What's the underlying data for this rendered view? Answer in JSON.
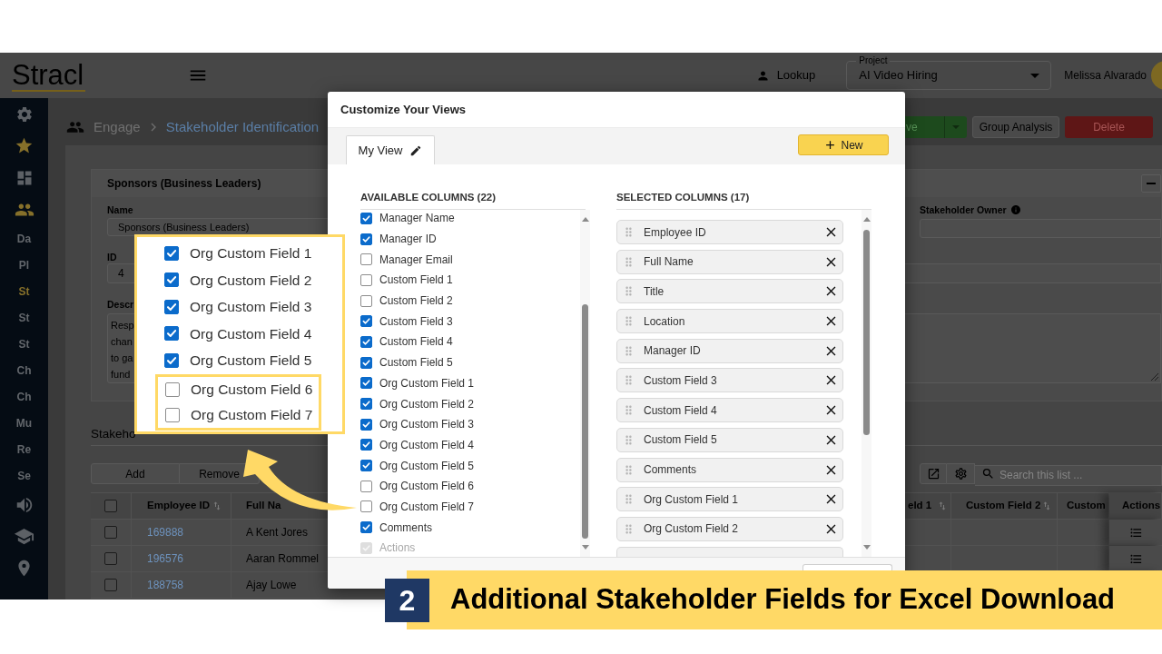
{
  "header": {
    "logo": "Stracl",
    "lookup": "Lookup",
    "project": {
      "label": "Project",
      "value": "AI Video Hiring"
    },
    "user": "Melissa Alvarado"
  },
  "sidebar": {
    "items": [
      {
        "kind": "icon",
        "highlighted": false
      },
      {
        "kind": "icon",
        "highlighted": true
      },
      {
        "kind": "icon",
        "highlighted": false
      },
      {
        "kind": "icon",
        "highlighted": true
      },
      {
        "kind": "text",
        "label": "Da",
        "highlighted": false
      },
      {
        "kind": "text",
        "label": "Pl",
        "highlighted": false
      },
      {
        "kind": "text",
        "label": "St",
        "highlighted": true
      },
      {
        "kind": "text",
        "label": "St",
        "highlighted": false
      },
      {
        "kind": "text",
        "label": "St",
        "highlighted": false
      },
      {
        "kind": "text",
        "label": "Ch",
        "highlighted": false
      },
      {
        "kind": "text",
        "label": "Ch",
        "highlighted": false
      },
      {
        "kind": "text",
        "label": "Mu",
        "highlighted": false
      },
      {
        "kind": "text",
        "label": "Re",
        "highlighted": false
      },
      {
        "kind": "text",
        "label": "Se",
        "highlighted": false
      },
      {
        "kind": "icon",
        "highlighted": false
      },
      {
        "kind": "icon",
        "highlighted": false
      },
      {
        "kind": "icon",
        "highlighted": false
      }
    ]
  },
  "breadcrumb": [
    "Engage",
    "Stakeholder Identification"
  ],
  "actions": [
    {
      "kind": "split",
      "label": "ve"
    },
    {
      "kind": "plain",
      "label": "Group Analysis"
    },
    {
      "kind": "danger",
      "label": "Delete"
    }
  ],
  "card": {
    "title": "Sponsors (Business Leaders)",
    "name": {
      "label": "Name",
      "value": "Sponsors (Business Leaders)"
    },
    "owner": {
      "label": "Stakeholder Owner"
    },
    "id": {
      "label": "ID",
      "value": "4"
    },
    "description": {
      "label": "Descr",
      "lines": [
        "Resp",
        "chan",
        "to ga",
        "fund"
      ]
    }
  },
  "stakeholders": {
    "title": "Stakeho",
    "buttons": [
      "Add",
      "Remove"
    ],
    "search": {
      "placeholder": "Search this list ..."
    }
  },
  "table": {
    "all_checked": false,
    "columns": [
      {
        "label": "Employee ID",
        "sortable": true
      },
      {
        "label": "Full Na",
        "sortable": false
      },
      {
        "label": "eld 1",
        "sortable": true
      },
      {
        "label": "Custom Field 2",
        "sortable": true
      },
      {
        "label": "Custom",
        "sortable": false
      },
      {
        "label": "Actions",
        "sortable": false
      }
    ],
    "rows": [
      {
        "checked": false,
        "cells": [
          "169888",
          "A Kent Jores"
        ],
        "menu": true
      },
      {
        "checked": false,
        "cells": [
          "196576",
          "Aaran Rommel"
        ],
        "menu": true
      },
      {
        "checked": false,
        "cells": [
          "188758",
          "Ajay Lowe"
        ]
      }
    ]
  },
  "modal": {
    "title": "Customize Your Views",
    "tabs": [
      {
        "label": "My View",
        "selected": true
      }
    ],
    "new_button": "New",
    "available": {
      "title": "AVAILABLE COLUMNS (22)",
      "items": [
        {
          "label": "Manager Name",
          "checked": true,
          "disabled": false
        },
        {
          "label": "Manager ID",
          "checked": true,
          "disabled": false
        },
        {
          "label": "Manager Email",
          "checked": false,
          "disabled": false
        },
        {
          "label": "Custom Field 1",
          "checked": false,
          "disabled": false
        },
        {
          "label": "Custom Field 2",
          "checked": false,
          "disabled": false
        },
        {
          "label": "Custom Field 3",
          "checked": true,
          "disabled": false
        },
        {
          "label": "Custom Field 4",
          "checked": true,
          "disabled": false
        },
        {
          "label": "Custom Field 5",
          "checked": true,
          "disabled": false
        },
        {
          "label": "Org Custom Field 1",
          "checked": true,
          "disabled": false
        },
        {
          "label": "Org Custom Field 2",
          "checked": true,
          "disabled": false
        },
        {
          "label": "Org Custom Field 3",
          "checked": true,
          "disabled": false
        },
        {
          "label": "Org Custom Field 4",
          "checked": true,
          "disabled": false
        },
        {
          "label": "Org Custom Field 5",
          "checked": true,
          "disabled": false
        },
        {
          "label": "Org Custom Field 6",
          "checked": false,
          "disabled": false
        },
        {
          "label": "Org Custom Field 7",
          "checked": false,
          "disabled": false
        },
        {
          "label": "Comments",
          "checked": true,
          "disabled": false
        },
        {
          "label": "Actions",
          "checked": true,
          "disabled": true
        }
      ]
    },
    "selected": {
      "title": "SELECTED COLUMNS (17)",
      "items": [
        "Employee ID",
        "Full Name",
        "Title",
        "Location",
        "Manager ID",
        "Custom Field 3",
        "Custom Field 4",
        "Custom Field 5",
        "Comments",
        "Org Custom Field 1",
        "Org Custom Field 2"
      ]
    }
  },
  "callout": {
    "items": [
      {
        "label": "Org Custom Field 1",
        "checked": true,
        "highlighted": false
      },
      {
        "label": "Org Custom Field 2",
        "checked": true,
        "highlighted": false
      },
      {
        "label": "Org Custom Field 3",
        "checked": true,
        "highlighted": false
      },
      {
        "label": "Org Custom Field 4",
        "checked": true,
        "highlighted": false
      },
      {
        "label": "Org Custom Field 5",
        "checked": true,
        "highlighted": false
      },
      {
        "label": "Org Custom Field 6",
        "checked": false,
        "highlighted": true
      },
      {
        "label": "Org Custom Field 7",
        "checked": false,
        "highlighted": true
      }
    ]
  },
  "banner": {
    "step": "2",
    "title": "Additional Stakeholder Fields for Excel Download"
  }
}
